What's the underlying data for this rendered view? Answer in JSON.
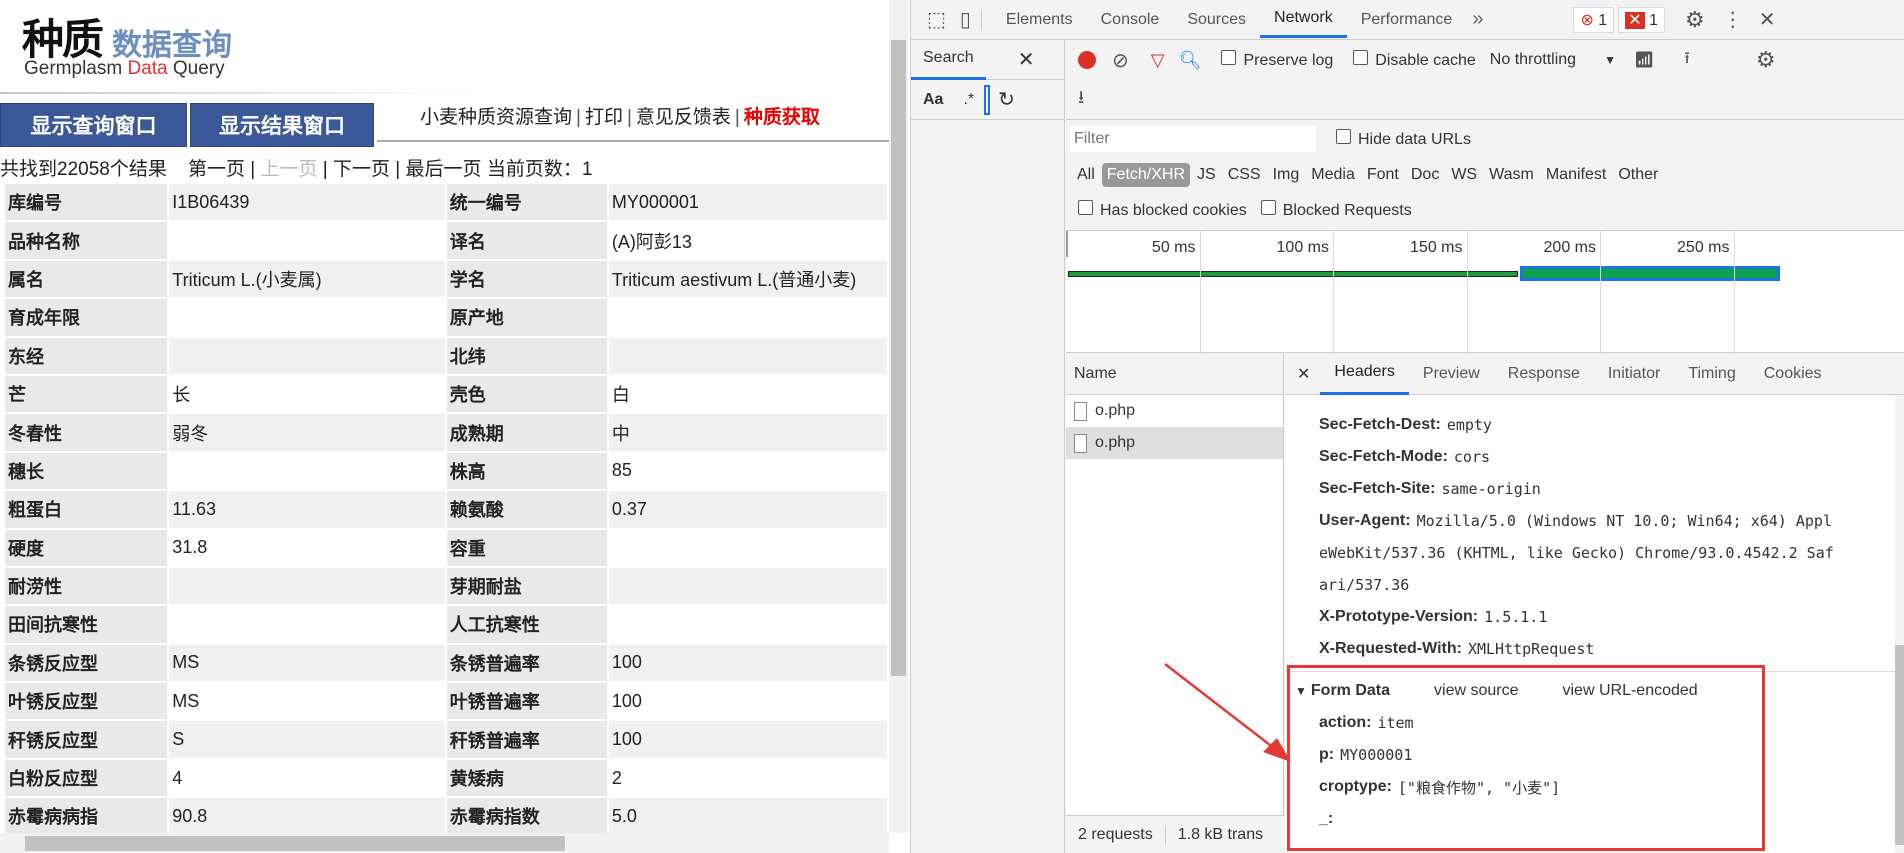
{
  "page": {
    "logo": {
      "main": "种质",
      "sub": "数据查询",
      "en_a": "Germplasm ",
      "en_b": "Data",
      "en_c": " Query"
    },
    "buttons": {
      "show_query": "显示查询窗口",
      "show_result": "显示结果窗口"
    },
    "links": {
      "wheat": "小麦种质资源查询",
      "print": "打印",
      "feedback": "意见反馈表",
      "acquire": "种质获取",
      "sep": "|"
    },
    "pager": {
      "count": "共找到22058个结果",
      "first": "第一页",
      "prev": "上一页",
      "next": "下一页",
      "last": "最后一页",
      "current": "当前页数：1"
    },
    "rows": [
      [
        "库编号",
        "I1B06439",
        "统一编号",
        "MY000001"
      ],
      [
        "品种名称",
        "",
        "译名",
        "(A)阿彭13"
      ],
      [
        "属名",
        "Triticum L.(小麦属)",
        "学名",
        "Triticum aestivum L.(普通小麦)"
      ],
      [
        "育成年限",
        "",
        "原产地",
        ""
      ],
      [
        "东经",
        "",
        "北纬",
        ""
      ],
      [
        "芒",
        "长",
        "壳色",
        "白"
      ],
      [
        "冬春性",
        "弱冬",
        "成熟期",
        "中"
      ],
      [
        "穗长",
        "",
        "株高",
        "85"
      ],
      [
        "粗蛋白",
        "11.63",
        "赖氨酸",
        "0.37"
      ],
      [
        "硬度",
        "31.8",
        "容重",
        ""
      ],
      [
        "耐涝性",
        "",
        "芽期耐盐",
        ""
      ],
      [
        "田间抗寒性",
        "",
        "人工抗寒性",
        ""
      ],
      [
        "条锈反应型",
        "MS",
        "条锈普遍率",
        "100"
      ],
      [
        "叶锈反应型",
        "MS",
        "叶锈普遍率",
        "100"
      ],
      [
        "秆锈反应型",
        "S",
        "秆锈普遍率",
        "100"
      ],
      [
        "白粉反应型",
        "4",
        "黄矮病",
        "2"
      ],
      [
        "赤霉病病指",
        "90.8",
        "赤霉病指数",
        "5.0"
      ]
    ]
  },
  "devtools": {
    "tabs": [
      "Elements",
      "Console",
      "Sources",
      "Network",
      "Performance"
    ],
    "more": "»",
    "errors": "1",
    "warnings": "1",
    "search": {
      "label": "Search",
      "aa": "Aa",
      "regex": ".*"
    },
    "toolbar": {
      "preserve": "Preserve log",
      "disable_cache": "Disable cache",
      "throttle": "No throttling"
    },
    "filter": {
      "placeholder": "Filter",
      "hide_data": "Hide data URLs"
    },
    "types": [
      "All",
      "Fetch/XHR",
      "JS",
      "CSS",
      "Img",
      "Media",
      "Font",
      "Doc",
      "WS",
      "Wasm",
      "Manifest",
      "Other"
    ],
    "blocked": {
      "cookies": "Has blocked cookies",
      "requests": "Blocked Requests"
    },
    "timeline": [
      "50 ms",
      "100 ms",
      "150 ms",
      "200 ms",
      "250 ms"
    ],
    "name_header": "Name",
    "requests": [
      "o.php",
      "o.php"
    ],
    "status": {
      "requests": "2 requests",
      "transferred": "1.8 kB trans"
    },
    "detail_tabs": [
      "Headers",
      "Preview",
      "Response",
      "Initiator",
      "Timing",
      "Cookies"
    ],
    "headers": [
      {
        "k": "Sec-Fetch-Dest:",
        "v": "empty"
      },
      {
        "k": "Sec-Fetch-Mode:",
        "v": "cors"
      },
      {
        "k": "Sec-Fetch-Site:",
        "v": "same-origin"
      },
      {
        "k": "User-Agent:",
        "v": "Mozilla/5.0 (Windows NT 10.0; Win64; x64) Appl"
      },
      {
        "k": "",
        "v": "eWebKit/537.36 (KHTML, like Gecko) Chrome/93.0.4542.2 Saf"
      },
      {
        "k": "",
        "v": "ari/537.36"
      },
      {
        "k": "X-Prototype-Version:",
        "v": "1.5.1.1"
      },
      {
        "k": "X-Requested-With:",
        "v": "XMLHttpRequest"
      }
    ],
    "form": {
      "title": "Form Data",
      "view_source": "view source",
      "view_url": "view URL-encoded",
      "fields": [
        {
          "k": "action:",
          "v": "item"
        },
        {
          "k": "p:",
          "v": "MY000001"
        },
        {
          "k": "croptype:",
          "v": "[\"粮食作物\", \"小麦\"]"
        },
        {
          "k": "_:",
          "v": ""
        }
      ]
    },
    "colors": {
      "accent": "#1a73e8",
      "highlight_box": "#e53935",
      "record": "#d93025"
    }
  }
}
